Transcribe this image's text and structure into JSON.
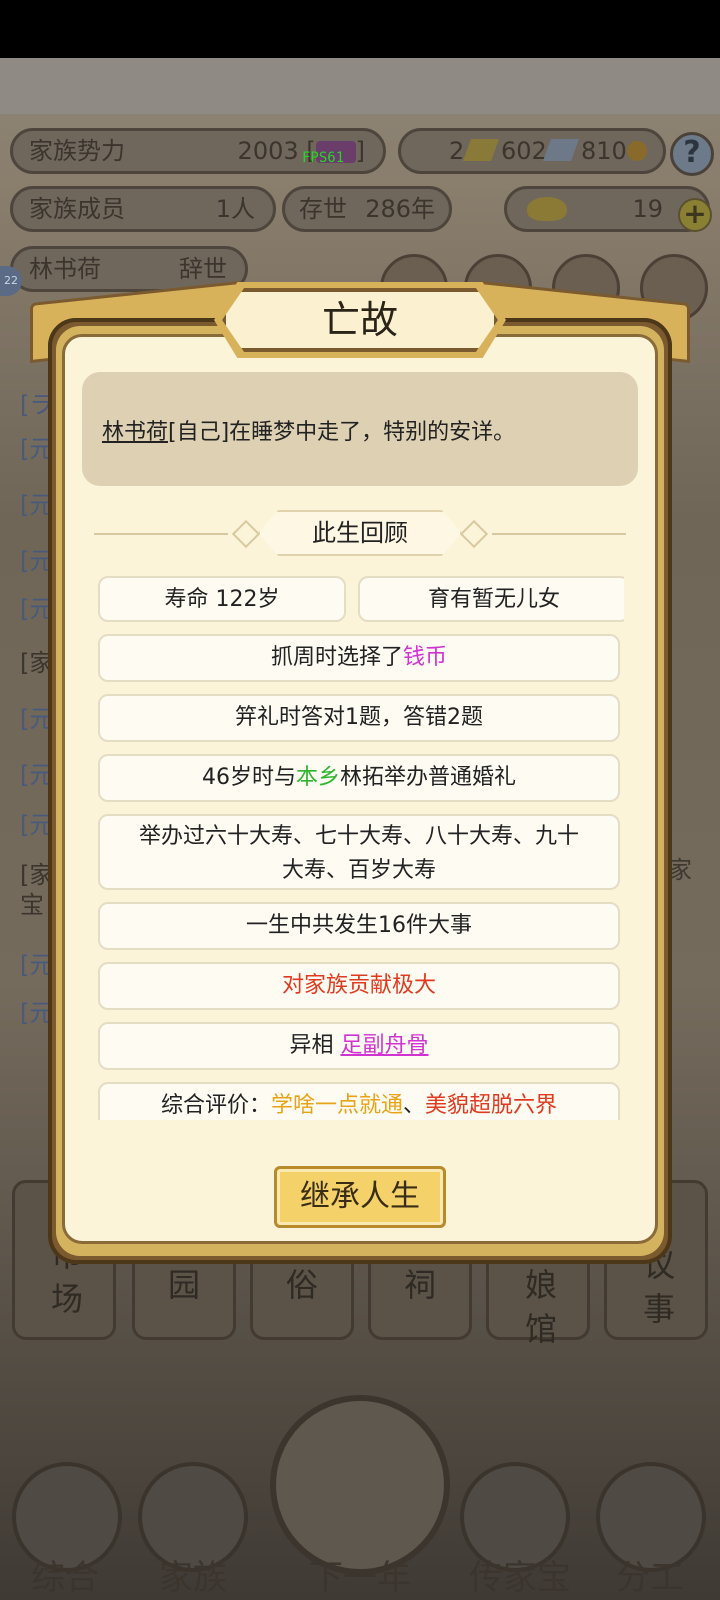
{
  "hud": {
    "power_label": "家族势力",
    "power_value": "2003 [",
    "power_suffix": "]",
    "fps": "FPS61",
    "gold_count": "2",
    "silver_count": "602",
    "silk_count": "810",
    "members_label": "家族成员",
    "members_value": "1人",
    "existence_label": "存世",
    "existence_value": "286年",
    "ingot_value": "19",
    "person_name": "林书荷",
    "person_status": "辞世",
    "level_badge": "22"
  },
  "modal": {
    "title": "亡故",
    "message_name": "林书荷",
    "message_rest": "[自己]在睡梦中走了，特别的安详。",
    "section_title": "此生回顾",
    "lifespan": "寿命 122岁",
    "children": "育有暂无儿女",
    "zhuazhou_prefix": "抓周时选择了",
    "zhuazhou_item": "钱币",
    "jili": "笄礼时答对1题，答错2题",
    "marriage_prefix": "46岁时与",
    "marriage_place": "本乡",
    "marriage_suffix": "林拓举办普通婚礼",
    "birthdays": "举办过六十大寿、七十大寿、八十大寿、九十大寿、百岁大寿",
    "events": "一生中共发生16件大事",
    "contribution": "对家族贡献极大",
    "omen_prefix": "异相",
    "omen_value": "足副舟骨",
    "eval_prefix": "综合评价：",
    "eval_1": "学啥一点就通",
    "eval_sep": "、",
    "eval_2": "美貌超脱六界",
    "inherit_button": "继承人生"
  },
  "background": {
    "log_prefixes": [
      "[ラ",
      "[元",
      "[元",
      "[元",
      "[元",
      "[家",
      "[元",
      "[元",
      "[元",
      "[家",
      "宝",
      "[元",
      "[元"
    ],
    "right_fragment": "家",
    "buildings": [
      "市场",
      "园",
      "俗",
      "祠",
      "娘馆",
      "议事"
    ],
    "nav": [
      "综合",
      "家族",
      "下一年",
      "传家宝",
      "分工"
    ]
  },
  "colors": {
    "highlight_pink": "#d133d1",
    "highlight_green": "#2fb52f",
    "highlight_red": "#e03a20",
    "highlight_orange": "#e8a317",
    "button_gold": "#f5d16a"
  }
}
